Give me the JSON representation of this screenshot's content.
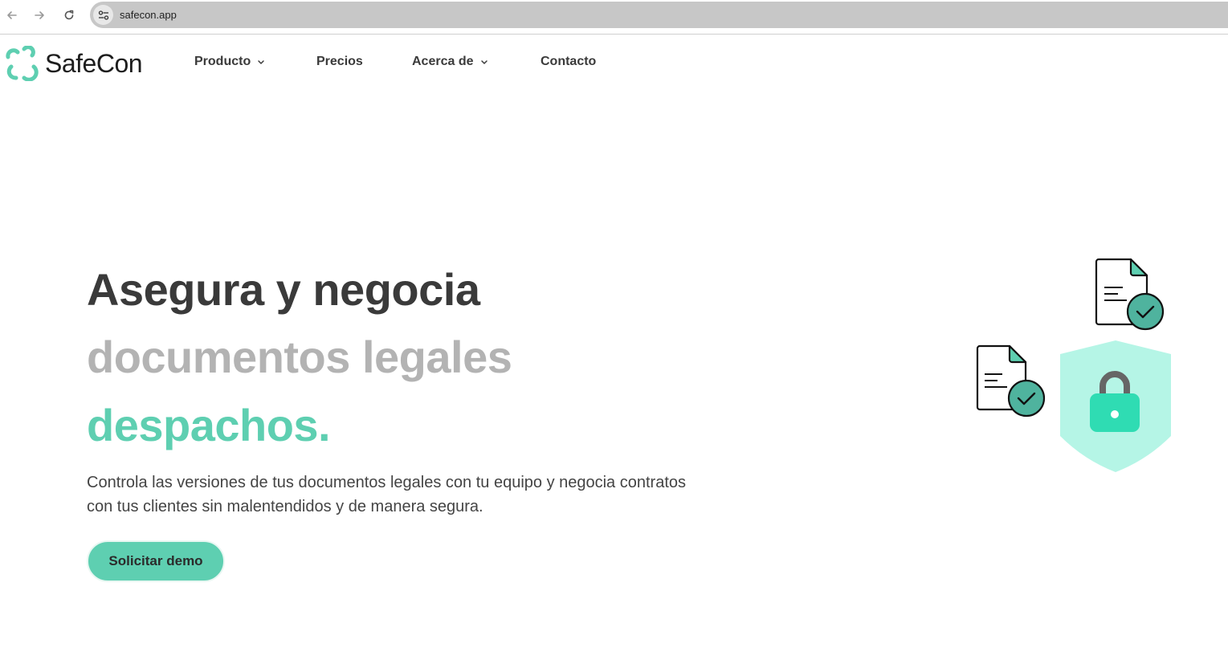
{
  "browser": {
    "url": "safecon.app"
  },
  "site": {
    "brand": "SafeCon",
    "nav": [
      {
        "label": "Producto",
        "has_dropdown": true
      },
      {
        "label": "Precios",
        "has_dropdown": false
      },
      {
        "label": "Acerca de",
        "has_dropdown": true
      },
      {
        "label": "Contacto",
        "has_dropdown": false
      }
    ]
  },
  "hero": {
    "line1": "Asegura y negocia",
    "line2": "documentos legales",
    "line3": "despachos.",
    "description": "Controla las versiones de tus documentos legales con tu equipo y negocia contratos con tus clientes sin malentendidos y de manera segura.",
    "cta_label": "Solicitar demo"
  },
  "colors": {
    "accent": "#5ecfb1",
    "accent_light": "#b5f5e6",
    "lock": "#2fdcb3",
    "heading_dark": "#3a3a3a",
    "heading_gray": "#b3b3b3"
  },
  "icons": {
    "back": "arrow-left-icon",
    "forward": "arrow-right-icon",
    "reload": "reload-icon",
    "site_info": "tune-icon",
    "logo": "safecon-logo-icon",
    "dropdown": "chevron-down-icon",
    "illustration": [
      "document-check-icon",
      "document-check-icon",
      "shield-lock-icon"
    ]
  }
}
